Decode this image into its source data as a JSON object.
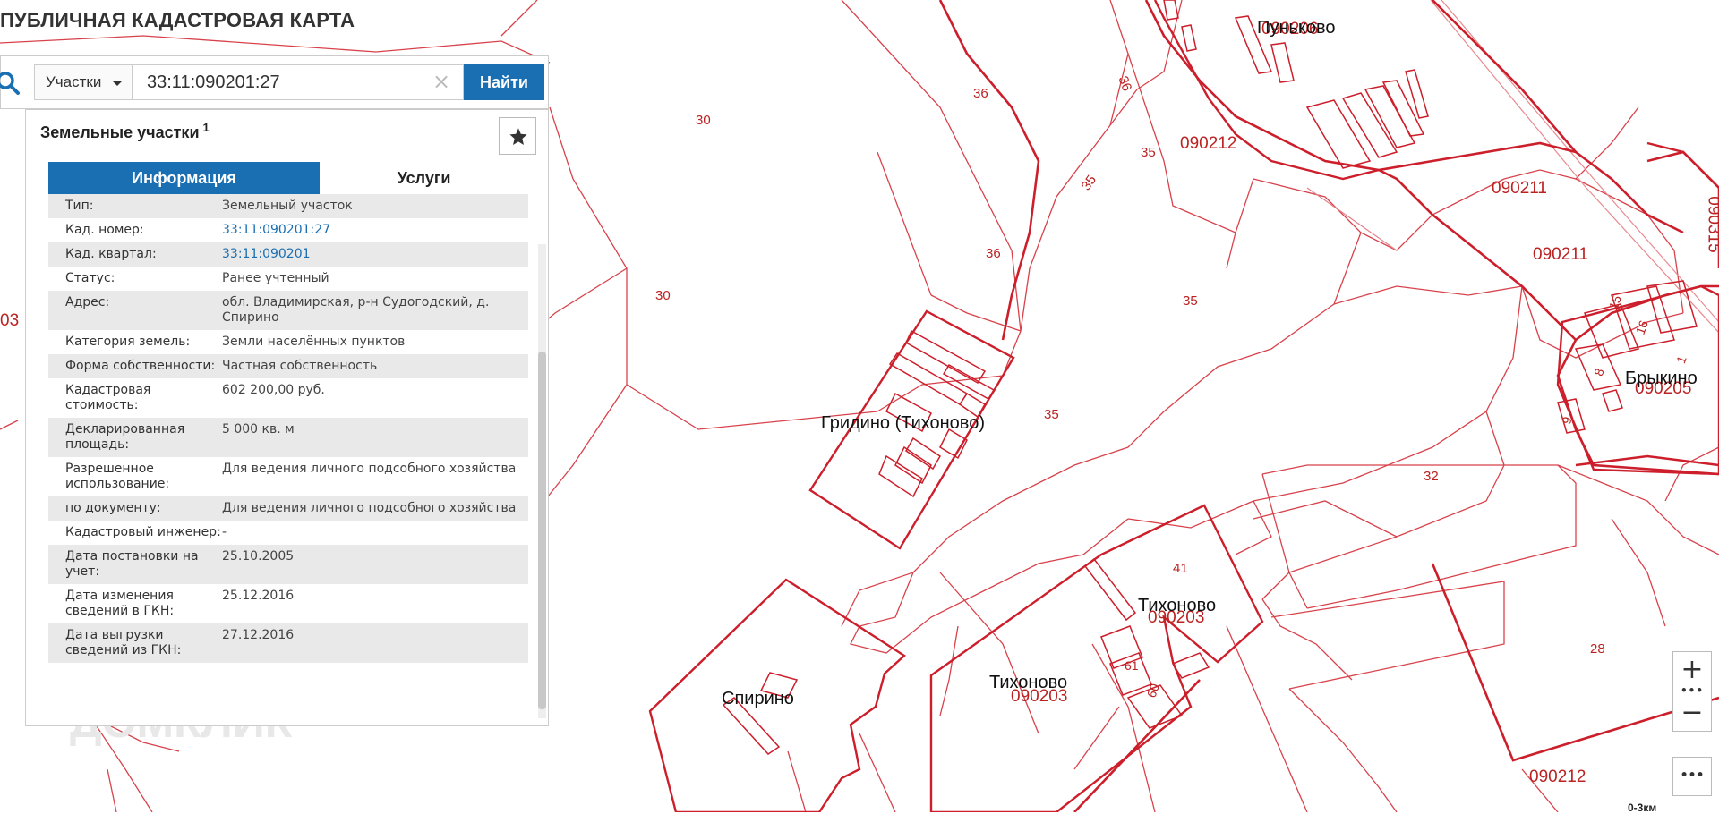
{
  "app": {
    "title": "ПУБЛИЧНАЯ КАДАСТРОВАЯ КАРТА"
  },
  "search": {
    "type_label": "Участки",
    "query": "33:11:090201:27",
    "find_label": "Найти"
  },
  "panel": {
    "title": "Земельные участки",
    "count": "1",
    "tabs": {
      "info": "Информация",
      "services": "Услуги"
    },
    "rows": [
      {
        "key": "Тип:",
        "value": "Земельный участок"
      },
      {
        "key": "Кад. номер:",
        "value": "33:11:090201:27"
      },
      {
        "key": "Кад. квартал:",
        "value": "33:11:090201"
      },
      {
        "key": "Статус:",
        "value": "Ранее учтенный"
      },
      {
        "key": "Адрес:",
        "value": "обл. Владимирская, р-н Судогодский, д. Спирино"
      },
      {
        "key": "Категория земель:",
        "value": "Земли населённых пунктов"
      },
      {
        "key": "Форма собственности:",
        "value": "Частная собственность"
      },
      {
        "key": "Кадастровая стоимость:",
        "value": "602 200,00 руб."
      },
      {
        "key": "Декларированная площадь:",
        "value": "5 000 кв. м"
      },
      {
        "key": "Разрешенное использование:",
        "value": "Для ведения личного подсобного хозяйства"
      },
      {
        "key": "по документу:",
        "value": "Для ведения личного подсобного хозяйства"
      },
      {
        "key": "Кадастровый инженер:",
        "value": "-"
      },
      {
        "key": "Дата постановки на учет:",
        "value": "25.10.2005"
      },
      {
        "key": "Дата изменения сведений в ГКН:",
        "value": "25.12.2016"
      },
      {
        "key": "Дата выгрузки сведений из ГКН:",
        "value": "27.12.2016"
      }
    ]
  },
  "map": {
    "settlements": {
      "gridino": "Гридино (Тихоново)",
      "spirino": "Спирино",
      "tikhonovo_a": "Тихоново",
      "tikhonovo_b": "Тихоново",
      "brykino": "Брыкино",
      "punkovo": "Пуньково"
    },
    "quarters": {
      "q090212a": "090212",
      "q090212b": "090212",
      "q090211a": "090211",
      "q090211b": "090211",
      "q090203a": "090203",
      "q090203b": "090203",
      "q090205": "090205",
      "q090206": "090206",
      "q090315": "090315",
      "q03": "03"
    },
    "parcels": {
      "p30a": "30",
      "p30b": "30",
      "p36a": "36",
      "p36b": "36",
      "p36c": "36",
      "p35a": "35",
      "p35b": "35",
      "p35c": "35",
      "p35d": "35",
      "p32": "32",
      "p41": "41",
      "p28": "28",
      "p61": "61",
      "p60": "60",
      "p16": "16",
      "p15": "15",
      "p8": "8",
      "p9": "9",
      "p1": "1"
    },
    "scale_label": "0-3км",
    "watermark": "ДОМКЛИК"
  },
  "controls": {
    "zoom_in": "+",
    "zoom_out": "−",
    "dots": "•••",
    "more": "•••"
  },
  "colors": {
    "boundary": "#cc1f2b",
    "accent": "#1a6fb3"
  }
}
